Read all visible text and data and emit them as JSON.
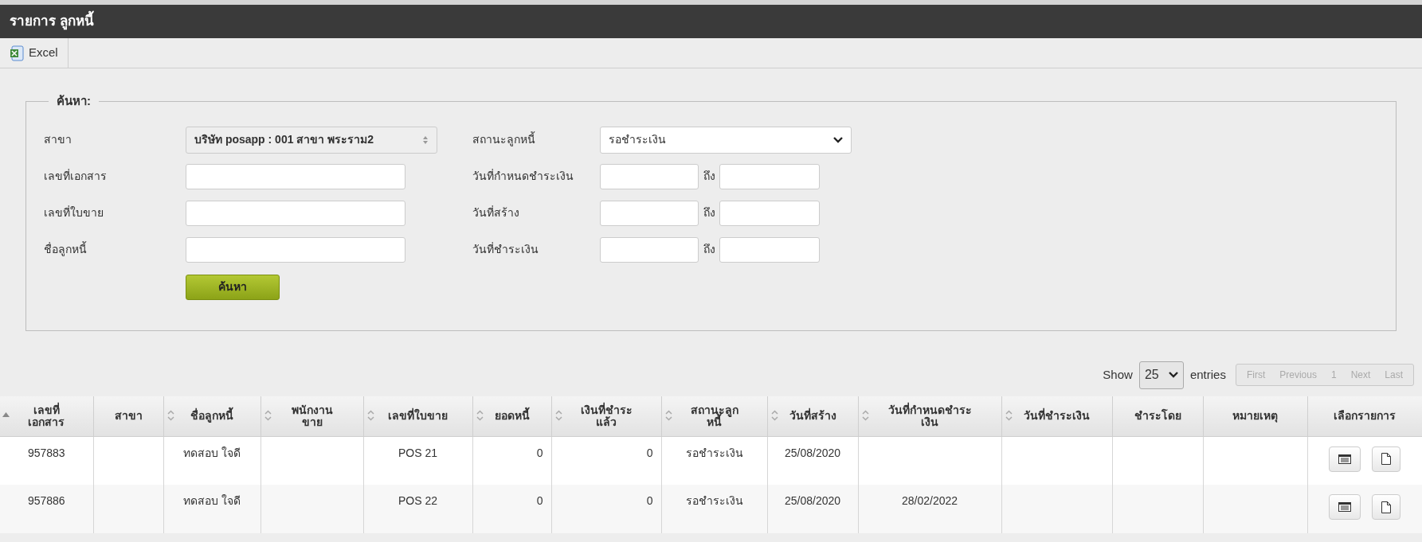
{
  "window": {
    "title": "รายการ ลูกหนี้"
  },
  "toolbar": {
    "buttons": [
      {
        "label": "Excel"
      }
    ]
  },
  "search": {
    "legend": "ค้นหา:",
    "left_fields": [
      {
        "label": "สาขา",
        "kind": "select",
        "value": "บริษัท posapp : 001 สาขา พระราม2",
        "disabled": true
      },
      {
        "label": "เลขที่เอกสาร",
        "kind": "text"
      },
      {
        "label": "เลขที่ใบขาย",
        "kind": "text"
      },
      {
        "label": "ชื่อลูกหนี้",
        "kind": "text"
      }
    ],
    "right_fields": [
      {
        "label": "สถานะลูกหนี้",
        "kind": "select",
        "value": "รอชำระเงิน"
      },
      {
        "label": "วันที่กำหนดชำระเงิน",
        "kind": "range",
        "separator": "ถึง"
      },
      {
        "label": "วันที่สร้าง",
        "kind": "range",
        "separator": "ถึง"
      },
      {
        "label": "วันที่ชำระเงิน",
        "kind": "range",
        "separator": "ถึง"
      }
    ],
    "button": "ค้นหา"
  },
  "length": {
    "prefix": "Show",
    "value": "25",
    "suffix": "entries"
  },
  "pagination": [
    {
      "label": "First",
      "disabled": true
    },
    {
      "label": "Previous",
      "disabled": true
    },
    {
      "label": "1",
      "disabled": true
    },
    {
      "label": "Next",
      "disabled": true
    },
    {
      "label": "Last",
      "disabled": true
    }
  ],
  "table": {
    "columns": [
      {
        "label": "เลขที่\nเอกสาร",
        "sortable": true,
        "sorted": true
      },
      {
        "label": "สาขา",
        "sortable": false,
        "sorted": false
      },
      {
        "label": "ชื่อลูกหนี้",
        "sortable": true,
        "sorted": false
      },
      {
        "label": "พนักงาน\nขาย",
        "sortable": true,
        "sorted": false
      },
      {
        "label": "เลขที่ใบขาย",
        "sortable": true,
        "sorted": false
      },
      {
        "label": "ยอดหนี้",
        "sortable": true,
        "sorted": false
      },
      {
        "label": "เงินที่ชำระ\nแล้ว",
        "sortable": true,
        "sorted": false
      },
      {
        "label": "สถานะลูก\nหนี้",
        "sortable": true,
        "sorted": false
      },
      {
        "label": "วันที่สร้าง",
        "sortable": true,
        "sorted": false
      },
      {
        "label": "วันที่กำหนดชำระ\nเงิน",
        "sortable": true,
        "sorted": false
      },
      {
        "label": "วันที่ชำระเงิน",
        "sortable": true,
        "sorted": false
      },
      {
        "label": "ชำระโดย",
        "sortable": false,
        "sorted": false
      },
      {
        "label": "หมายเหตุ",
        "sortable": false,
        "sorted": false
      },
      {
        "label": "เลือกรายการ",
        "sortable": false,
        "sorted": false
      }
    ],
    "rows": [
      {
        "cells": [
          "957883",
          "",
          "ทดสอบ ใจดี",
          "",
          "POS 21",
          "0",
          "0",
          "รอชำระเงิน",
          "25/08/2020",
          "",
          "",
          "",
          ""
        ]
      },
      {
        "cells": [
          "957886",
          "",
          "ทดสอบ ใจดี",
          "",
          "POS 22",
          "0",
          "0",
          "รอชำระเงิน",
          "25/08/2020",
          "28/02/2022",
          "",
          "",
          ""
        ]
      }
    ]
  }
}
